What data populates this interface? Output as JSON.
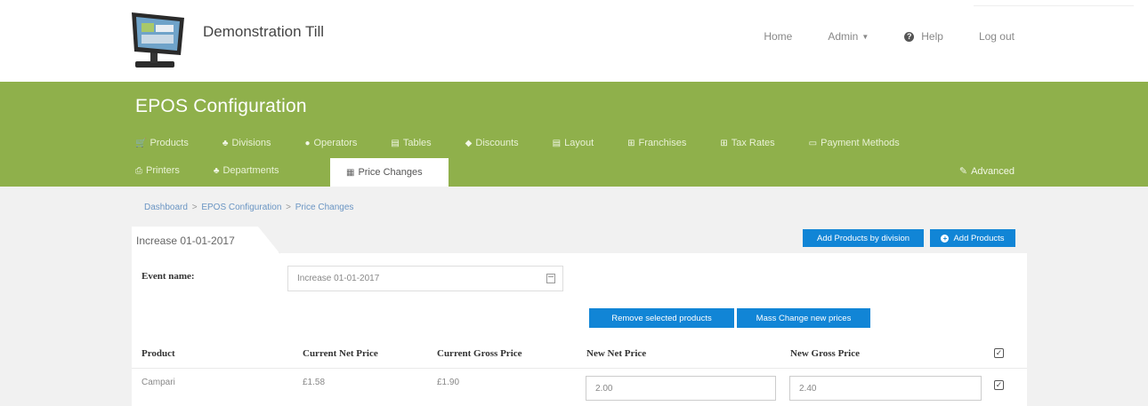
{
  "app": {
    "title": "Demonstration Till"
  },
  "topnav": {
    "home": "Home",
    "admin": "Admin",
    "help": "Help",
    "logout": "Log out"
  },
  "header": {
    "page_title": "EPOS Configuration"
  },
  "tabs_row1": [
    {
      "label": "Products",
      "icon": "cart-icon"
    },
    {
      "label": "Divisions",
      "icon": "sitemap-icon"
    },
    {
      "label": "Operators",
      "icon": "users-icon"
    },
    {
      "label": "Tables",
      "icon": "table-icon"
    },
    {
      "label": "Discounts",
      "icon": "tag-icon"
    },
    {
      "label": "Layout",
      "icon": "layout-icon"
    },
    {
      "label": "Franchises",
      "icon": "grid-icon"
    },
    {
      "label": "Tax Rates",
      "icon": "grid-icon"
    },
    {
      "label": "Payment Methods",
      "icon": "card-icon"
    }
  ],
  "tabs_row2": [
    {
      "label": "Printers",
      "icon": "printer-icon"
    },
    {
      "label": "Departments",
      "icon": "sitemap-icon"
    }
  ],
  "active_tab": {
    "label": "Price Changes",
    "icon": "calendar-icon"
  },
  "advanced_tab": {
    "label": "Advanced",
    "icon": "wrench-icon"
  },
  "breadcrumb": {
    "items": [
      "Dashboard",
      "EPOS Configuration",
      "Price Changes"
    ],
    "separator": ">"
  },
  "panel": {
    "tab_label": "Increase 01-01-2017",
    "add_by_division_label": "Add Products by division",
    "add_products_label": "Add Products",
    "event_name_label": "Event name:",
    "event_name_value": "Increase 01-01-2017",
    "remove_selected_label": "Remove selected products",
    "mass_change_label": "Mass Change new prices"
  },
  "table": {
    "columns": [
      "Product",
      "Current Net Price",
      "Current Gross Price",
      "New Net Price",
      "New Gross Price"
    ],
    "rows": [
      {
        "product": "Campari",
        "current_net": "£1.58",
        "current_gross": "£1.90",
        "new_net": "2.00",
        "new_gross": "2.40",
        "checked": true
      }
    ],
    "header_checked": true
  },
  "colors": {
    "brand_green": "#8fb04b",
    "button_blue": "#1185d6",
    "content_bg": "#f1f1f1"
  }
}
